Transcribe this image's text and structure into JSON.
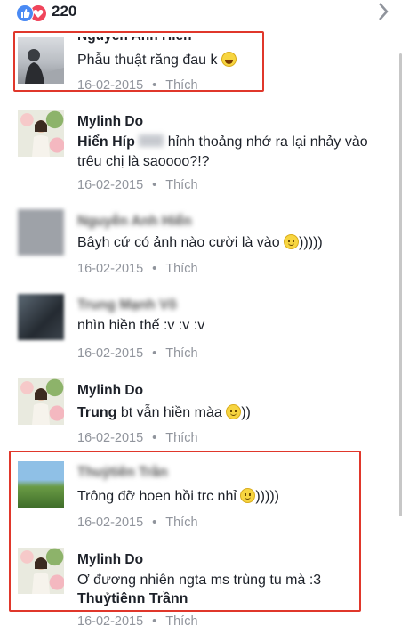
{
  "reactions": {
    "count": "220",
    "like_color": "#4a8af4",
    "love_color": "#f0455b"
  },
  "comments": [
    {
      "name": "Nguyễn Anh Hiển",
      "name_blurred": false,
      "text": "Phẫu thuật răng đau k",
      "date": "16-02-2015",
      "action": "Thích",
      "emoji": "laugh",
      "avatar": "snow-portrait"
    },
    {
      "name": "Mylinh Do",
      "name_blurred": false,
      "text_bold": "Hiển Híp",
      "text_rest": "hỉnh thoảng nhớ ra lại nhảy vào trêu chị là saoooo?!?",
      "date": "16-02-2015",
      "action": "Thích",
      "avatar": "woman-flowers"
    },
    {
      "name": "Nguyễn Anh Hiển",
      "name_blurred": true,
      "text": "Bâyh cứ có ảnh nào cười là vào",
      "text_after": ")))))",
      "date": "16-02-2015",
      "action": "Thích",
      "emoji": "smiley",
      "avatar": "blurred-gray"
    },
    {
      "name": "Trung Mạnh Võ",
      "name_blurred": true,
      "text": "nhìn hiền thế :v :v :v",
      "date": "16-02-2015",
      "action": "Thích",
      "avatar": "blurred-dark"
    },
    {
      "name": "Mylinh Do",
      "name_blurred": false,
      "text_bold": "Trung",
      "text_rest": "bt vẫn hiền màa",
      "text_after": "))",
      "date": "16-02-2015",
      "action": "Thích",
      "emoji": "smiley",
      "avatar": "woman-flowers"
    },
    {
      "name": "Thuỷtiên Trần",
      "name_blurred": true,
      "text": "Trông đỡ hoen hồi trc nhỉ",
      "text_after": ")))))",
      "date": "16-02-2015",
      "action": "Thích",
      "emoji": "smiley",
      "avatar": "green-landscape"
    },
    {
      "name": "Mylinh Do",
      "name_blurred": false,
      "text": "Ơ đương nhiên ngta ms trùng tu mà :3",
      "text_bold2": "Thuỷtiênn Trầnn",
      "date": "16-02-2015",
      "action": "Thích",
      "avatar": "woman-flowers"
    }
  ],
  "highlight_color": "#e0372b"
}
